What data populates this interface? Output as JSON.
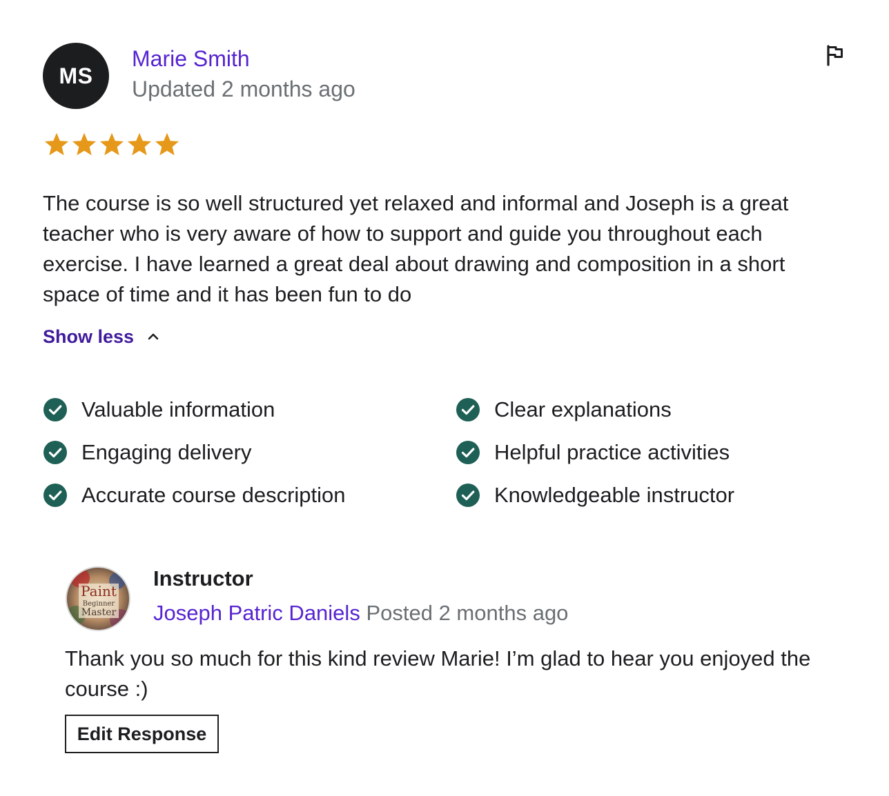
{
  "review": {
    "avatar_initials": "MS",
    "reviewer_name": "Marie Smith",
    "updated": "Updated 2 months ago",
    "rating": 5,
    "rating_max": 5,
    "star_color": "#e59819",
    "text": "The course is so well structured yet relaxed and informal and Joseph is a great teacher who is very aware of how to support and guide you throughout each exercise. I have learned a great deal about drawing and composition in a short space of time and it has been fun to do",
    "toggle_label": "Show less",
    "toggle_icon": "chevron-up-icon",
    "report_icon": "flag-icon"
  },
  "features": {
    "check_icon": "check-circle-icon",
    "check_color": "#1e6055",
    "items": [
      "Valuable information",
      "Clear explanations",
      "Engaging delivery",
      "Helpful practice activities",
      "Accurate course description",
      "Knowledgeable instructor"
    ]
  },
  "response": {
    "role": "Instructor",
    "name": "Joseph Patric Daniels",
    "posted": "Posted 2 months ago",
    "text": "Thank you so much for this kind review Marie! I’m glad to hear you enjoyed the course :)",
    "edit_label": "Edit Response",
    "avatar_text": [
      "Paint",
      "Beginner",
      "Master"
    ]
  },
  "colors": {
    "link_purple": "#5624d0",
    "toggle_purple": "#401b9c",
    "muted_gray": "#6a6f73",
    "text_dark": "#1c1d1f"
  }
}
